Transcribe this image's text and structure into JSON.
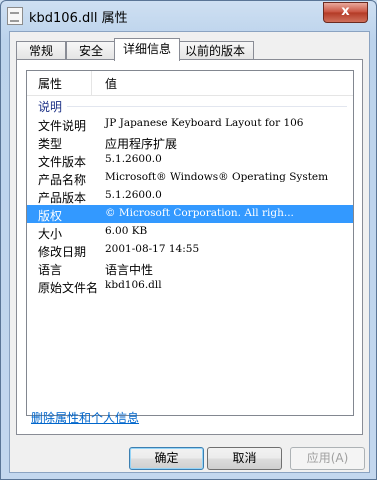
{
  "window": {
    "title": "kbd106.dll 属性",
    "close_glyph": "x"
  },
  "tabs": [
    {
      "label": "常规",
      "active": false
    },
    {
      "label": "安全",
      "active": false
    },
    {
      "label": "详细信息",
      "active": true
    },
    {
      "label": "以前的版本",
      "active": false
    }
  ],
  "list": {
    "col_property": "属性",
    "col_value": "值",
    "group": "说明",
    "rows": [
      {
        "key": "文件说明",
        "value": "JP Japanese Keyboard Layout for 106"
      },
      {
        "key": "类型",
        "value": "应用程序扩展"
      },
      {
        "key": "文件版本",
        "value": "5.1.2600.0"
      },
      {
        "key": "产品名称",
        "value": "Microsoft® Windows® Operating System"
      },
      {
        "key": "产品版本",
        "value": "5.1.2600.0"
      },
      {
        "key": "版权",
        "value": "© Microsoft Corporation. All righ...",
        "selected": true
      },
      {
        "key": "大小",
        "value": "6.00 KB"
      },
      {
        "key": "修改日期",
        "value": "2001-08-17 14:55"
      },
      {
        "key": "语言",
        "value": "语言中性"
      },
      {
        "key": "原始文件名",
        "value": "kbd106.dll"
      }
    ]
  },
  "link": "删除属性和个人信息",
  "buttons": {
    "ok": "确定",
    "cancel": "取消",
    "apply": "应用(A)"
  }
}
